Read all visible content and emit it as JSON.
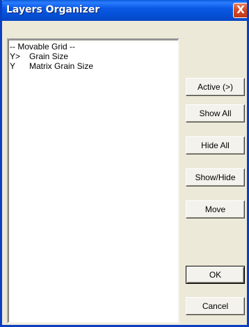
{
  "window": {
    "title": "Layers Organizer",
    "close_glyph": "X"
  },
  "layers_list": {
    "items": [
      {
        "prefix": "",
        "name": "-- Movable Grid --"
      },
      {
        "prefix": "Y>",
        "name": "Grain Size"
      },
      {
        "prefix": "Y",
        "name": "Matrix Grain Size"
      }
    ]
  },
  "buttons": {
    "active": "Active (>)",
    "show_all": "Show All",
    "hide_all": "Hide All",
    "show_hide": "Show/Hide",
    "move": "Move",
    "ok": "OK",
    "cancel": "Cancel"
  },
  "colors": {
    "titlebar": "#0451d6",
    "dialog_bg": "#ece9d8",
    "close_button": "#d44a24"
  }
}
